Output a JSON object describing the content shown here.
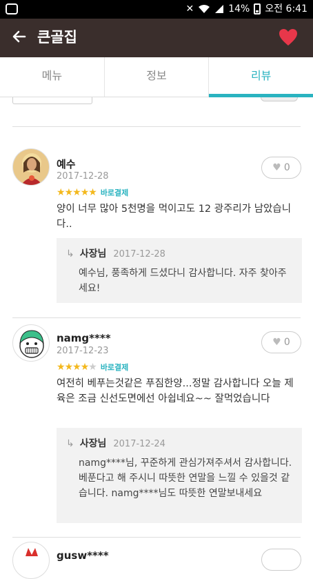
{
  "status_bar": {
    "battery": "14%",
    "time": "오전 6:41",
    "icons": [
      "app-icon",
      "mute-icon",
      "wifi-icon",
      "signal-icon",
      "battery-icon"
    ]
  },
  "app_bar": {
    "title": "큰골집",
    "back_icon": "back-arrow-icon",
    "favorite_icon": "heart-icon",
    "favorite_color": "#e8374a",
    "background": "#3a2e2c"
  },
  "tabs": [
    {
      "label": "메뉴",
      "active": false
    },
    {
      "label": "정보",
      "active": false
    },
    {
      "label": "리뷰",
      "active": true
    }
  ],
  "accent_color": "#2ab3c0",
  "reviews": [
    {
      "user": "예수",
      "date": "2017-12-28",
      "rating": 5,
      "badge": "바로결제",
      "likes": "0",
      "text": "양이 너무 많아 5천명을 먹이고도 12 광주리가 남았습니다..",
      "reply": {
        "author": "사장님",
        "date": "2017-12-28",
        "text": "예수님, 풍족하게 드셨다니 감사합니다. 자주 찾아주세요!"
      }
    },
    {
      "user": "namg****",
      "date": "2017-12-23",
      "rating": 4,
      "badge": "바로결제",
      "likes": "0",
      "text": "여전히 베푸는것같은 푸짐한양...정말 감사합니다 오늘 제육은 조금 신선도면에선 아쉽네요~~ 잘먹었습니다",
      "reply": {
        "author": "사장님",
        "date": "2017-12-24",
        "text": "namg****님, 꾸준하게 관심가져주셔서 감사합니다. 베푼다고 해 주시니 따뜻한 연말을 느낄 수 있을것 같습니다. namg****님도 따뜻한 연말보내세요"
      }
    },
    {
      "user": "gusw****"
    }
  ]
}
